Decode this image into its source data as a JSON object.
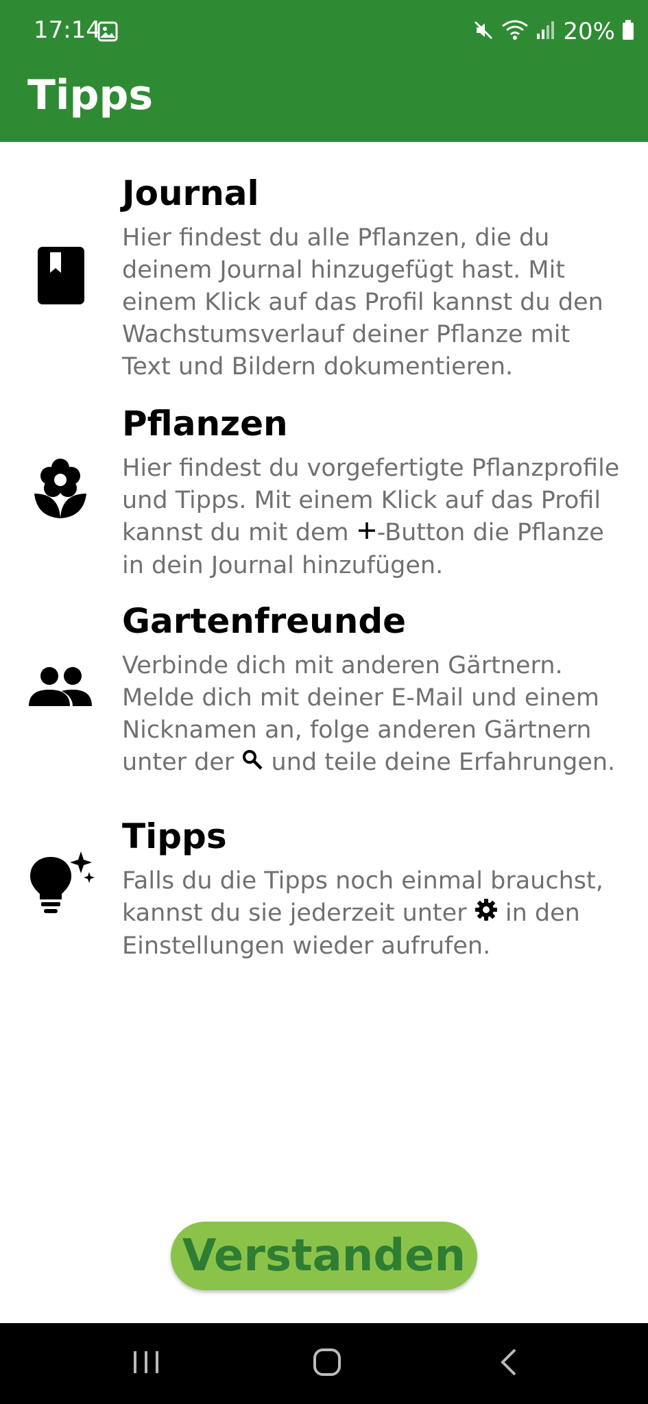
{
  "status_bar": {
    "time": "17:14",
    "battery": "20%"
  },
  "app_bar": {
    "title": "Tipps",
    "color": "#2e8b33"
  },
  "tips": [
    {
      "icon": "journal-book-icon",
      "title": "Journal",
      "lines": [
        "Hier findest du alle Pflanzen, die du",
        "deinem Journal hinzugefügt hast. Mit",
        "einem Klick auf das Profil kannst du den",
        "Wachstumsverlauf deiner Pflanze mit",
        "Text und Bildern dokumentieren."
      ]
    },
    {
      "icon": "flower-icon",
      "title": "Pflanzen",
      "lines": [
        "Hier findest du vorgefertigte Pflanzprofile",
        "und Tipps. Mit einem Klick auf das Profil"
      ],
      "line3_before": "kannst du mit dem ",
      "line3_after": "-Button die Pflanze",
      "line4": "in dein Journal hinzufügen."
    },
    {
      "icon": "people-icon",
      "title": "Gartenfreunde",
      "lines": [
        "Verbinde dich mit anderen Gärtnern.",
        "Melde dich mit deiner E-Mail und einem",
        "Nicknamen an, folge anderen Gärtnern"
      ],
      "line4_before": "unter der ",
      "line4_after": " und teile deine Erfahrungen."
    },
    {
      "icon": "lightbulb-sparkle-icon",
      "title": "Tipps",
      "line1": "Falls du die Tipps noch einmal brauchst,",
      "line2_before": "kannst du sie jederzeit unter ",
      "line2_after": " in den",
      "line3": "Einstellungen wieder aufrufen."
    }
  ],
  "confirm_button": {
    "label": "Verstanden",
    "color": "#8bc34a",
    "text_color": "#2e7d32"
  }
}
